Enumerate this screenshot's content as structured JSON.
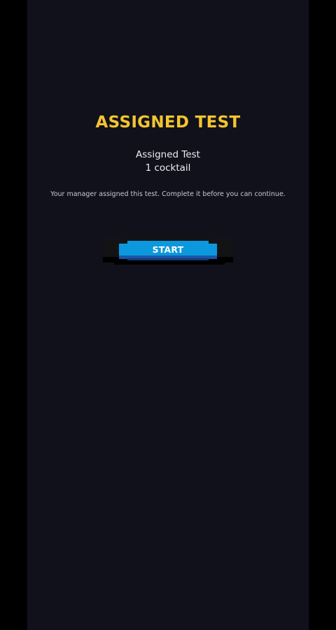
{
  "screen": {
    "title": "ASSIGNED TEST",
    "subtitle": "Assigned Test",
    "cocktail_count": "1 cocktail",
    "note": "Your manager assigned this test. Complete it before you can continue."
  },
  "actions": {
    "start_label": "START"
  },
  "colors": {
    "background": "#11111b",
    "title": "#f4c430",
    "button": "#0b98dc"
  }
}
